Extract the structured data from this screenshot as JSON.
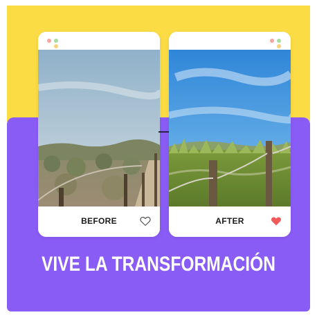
{
  "cards": {
    "before": {
      "label": "BEFORE",
      "icon": "heart-outline-icon"
    },
    "after": {
      "label": "AFTER",
      "icon": "heart-filled-icon"
    }
  },
  "headline": "VIVE LA TRANSFORMACIÓN",
  "colors": {
    "yellow_band": "#fcdc44",
    "purple_panel": "#8a5cf6",
    "heart_filled": "#f05a5a",
    "headline_text": "#ffffff"
  }
}
